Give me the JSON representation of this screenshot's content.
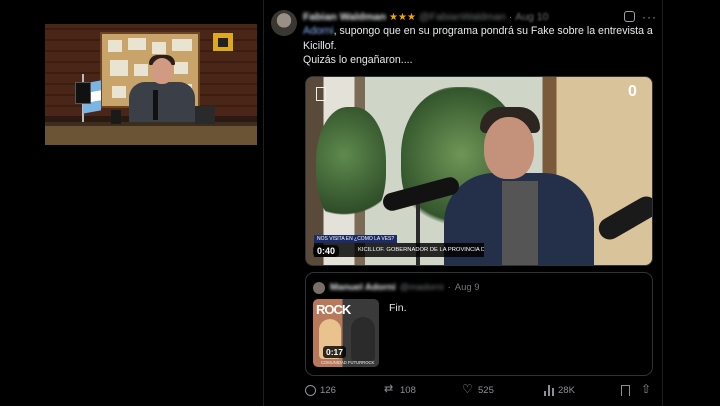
{
  "tweet": {
    "author_name": "Fabian Waldman",
    "badge": "★★★",
    "handle": "@FabianWaldman",
    "separator": "·",
    "date": "Aug 10",
    "mention": "Adorni",
    "text_line1": ", supongo que en su programa pondrá su Fake sobre la entrevista a",
    "text_line2": "Kicillof.",
    "text_line3": "Quizás lo engañaron...."
  },
  "media": {
    "logo": "0",
    "small_banner": "NOS VISITA EN ¿COMO LA VES?",
    "lower_third": "KICILLOF. GOBERNADOR DE LA PROVINCIA DE BUENOS AIRES",
    "duration": "0:40"
  },
  "quote": {
    "author_name": "Manuel Adorni",
    "handle": "@madorni",
    "separator": "·",
    "date": "Aug 9",
    "text": "Fin.",
    "thumb_title": "ROCK",
    "thumb_duration": "0:17",
    "thumb_caption": "COMUNIDAD FUTURROCK"
  },
  "actions": {
    "replies": "126",
    "retweets": "108",
    "likes": "525",
    "views": "28K"
  },
  "icons": {
    "grok": "grok-icon",
    "more": "more-icon",
    "reply": "reply-icon",
    "retweet": "retweet-icon",
    "like": "heart-icon",
    "views": "views-icon",
    "bookmark": "bookmark-icon",
    "share": "share-icon"
  },
  "colors": {
    "background": "#000000",
    "text": "#e7e9ea",
    "muted": "#71767b",
    "link": "#8ab4f8",
    "badge": "#f0a500"
  }
}
